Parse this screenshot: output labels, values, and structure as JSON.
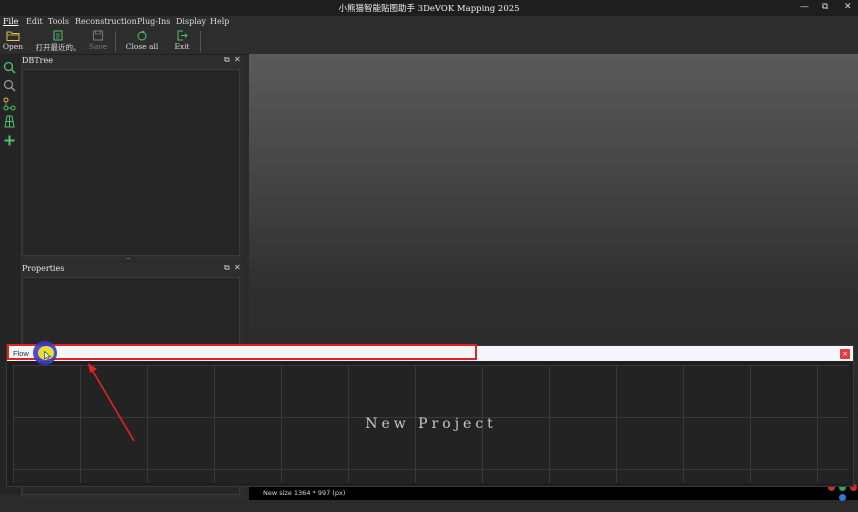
{
  "window": {
    "title": "小熊猫智能贴图助手 3DeVOK Mapping 2025",
    "controls": {
      "minimize": "—",
      "restore": "⧉",
      "close": "✕"
    }
  },
  "menu": [
    {
      "label": "File",
      "active": true
    },
    {
      "label": "Edit"
    },
    {
      "label": "Tools"
    },
    {
      "label": "Reconstruction"
    },
    {
      "label": "Plug-Ins"
    },
    {
      "label": "Display"
    },
    {
      "label": "Help"
    }
  ],
  "toolbar": {
    "open_label": "Open",
    "recent_label": "打开最近的。",
    "save_label": "Save",
    "close_all_label": "Close all",
    "exit_label": "Exit"
  },
  "left_strip_icons": [
    "search-icon",
    "zoom-icon",
    "node-graph-icon",
    "mesh-grid-icon",
    "add-icon"
  ],
  "dbtree": {
    "title": "DBTree",
    "float_glyph": "⧉",
    "close_glyph": "✕",
    "splitter_glyph": "…"
  },
  "properties": {
    "title": "Properties",
    "float_glyph": "⧉",
    "close_glyph": "✕"
  },
  "flow": {
    "title": "Flow",
    "close_glyph": "×",
    "canvas_text": "New Project"
  },
  "status": {
    "text": "New size 1364 * 997 (px)"
  },
  "colors": {
    "accent_folder": "#e0c33a",
    "accent_green": "#4fc36b",
    "annotation_red": "#e02424",
    "cursor_blue": "#3b3bc8",
    "cursor_yellow": "#e6e038"
  }
}
